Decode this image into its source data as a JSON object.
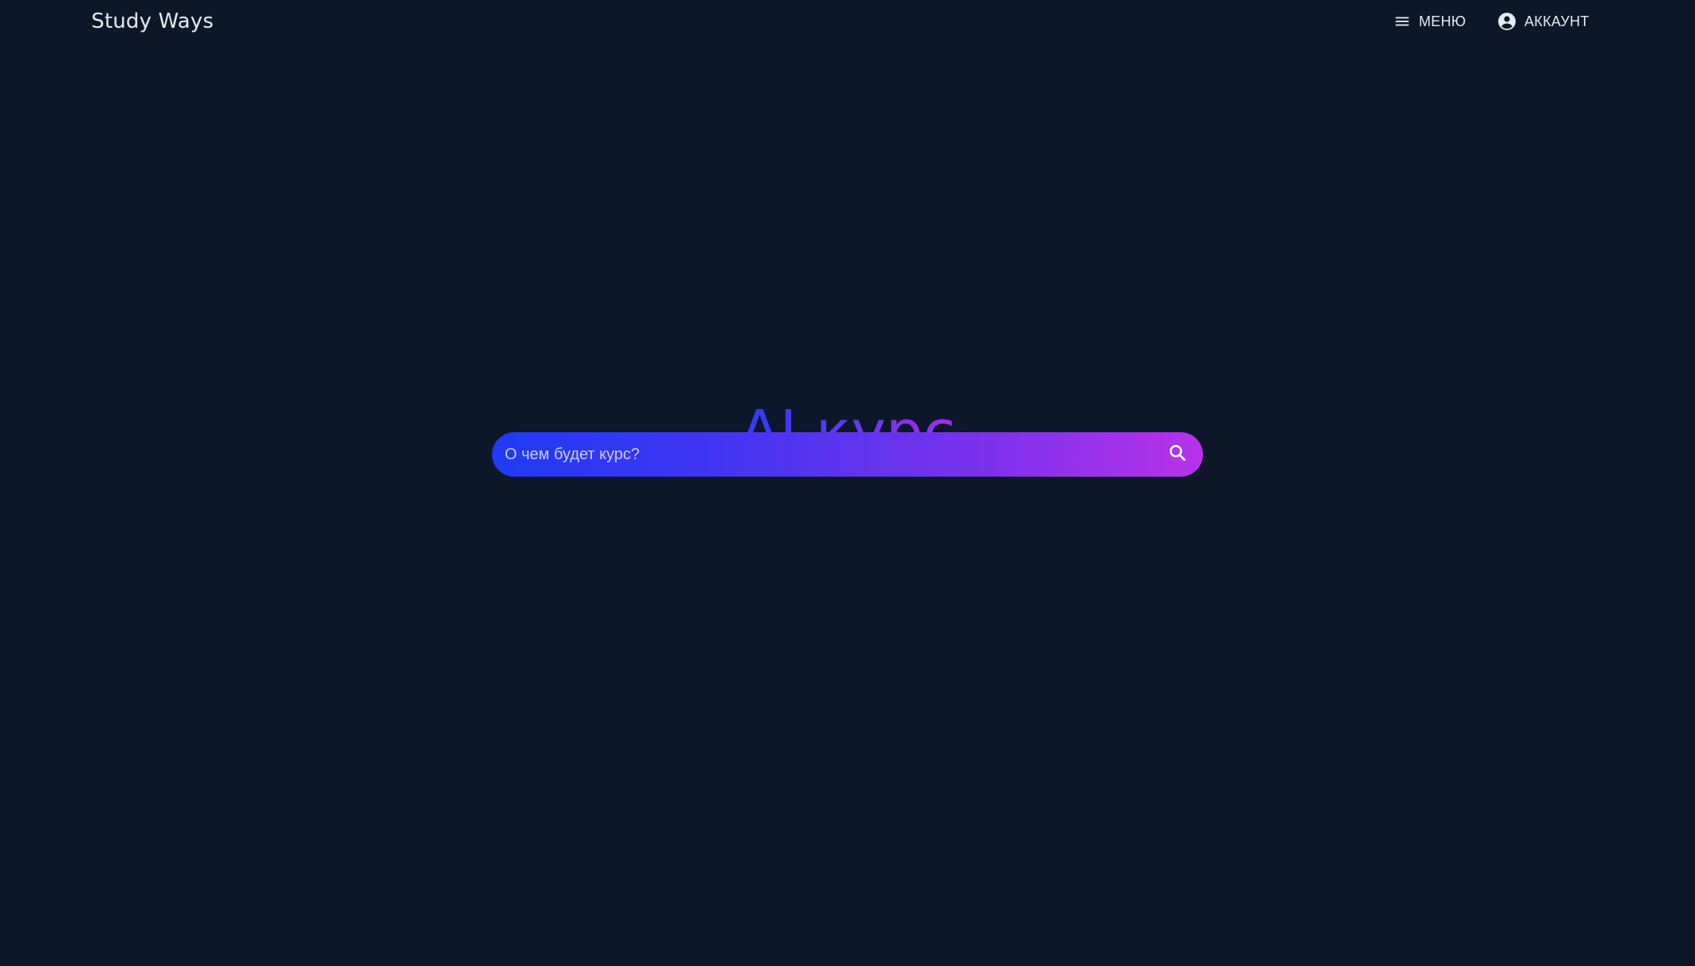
{
  "header": {
    "brand": "Study Ways",
    "menu_label": "МЕНЮ",
    "menu_icon": "hamburger-menu-icon",
    "account_label": "АККАУНТ",
    "account_icon": "account-circle-icon"
  },
  "hero": {
    "title": "AI курс"
  },
  "search": {
    "placeholder": "О чем будет курс?",
    "value": "",
    "button_icon": "search-icon"
  },
  "colors": {
    "background": "#0c1829",
    "gradient_start": "#1f3af7",
    "gradient_end": "#b832ea",
    "text": "#e6eaf1"
  }
}
